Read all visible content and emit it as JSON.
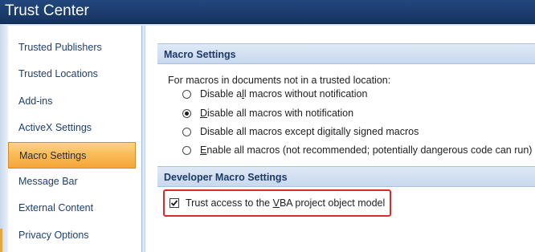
{
  "window": {
    "title": "Trust Center"
  },
  "sidebar": {
    "items": [
      {
        "label": "Trusted Publishers",
        "active": false
      },
      {
        "label": "Trusted Locations",
        "active": false
      },
      {
        "label": "Add-ins",
        "active": false
      },
      {
        "label": "ActiveX Settings",
        "active": false
      },
      {
        "label": "Macro Settings",
        "active": true
      },
      {
        "label": "Message Bar",
        "active": false
      },
      {
        "label": "External Content",
        "active": false
      },
      {
        "label": "Privacy Options",
        "active": false
      }
    ]
  },
  "macro_settings": {
    "header": "Macro Settings",
    "intro": "For macros in documents not in a trusted location:",
    "options": [
      {
        "pre": "Disable a",
        "accel": "l",
        "post": "l macros without notification",
        "selected": false
      },
      {
        "pre": "",
        "accel": "D",
        "post": "isable all macros with notification",
        "selected": true
      },
      {
        "pre": "Disable all macros except di",
        "accel": "g",
        "post": "itally signed macros",
        "selected": false
      },
      {
        "pre": "",
        "accel": "E",
        "post": "nable all macros (not recommended; potentially dangerous code can run)",
        "selected": false
      }
    ]
  },
  "developer_settings": {
    "header": "Developer Macro Settings",
    "checkbox": {
      "pre": "Trust access to the ",
      "accel": "V",
      "post": "BA project object model",
      "checked": true
    }
  },
  "colors": {
    "title_bar": "#1c3f71",
    "active_item": "#f9bc59",
    "highlight_box": "#d92b2b",
    "section_header": "#c8d8ee",
    "nav_text": "#1e3f6b"
  }
}
